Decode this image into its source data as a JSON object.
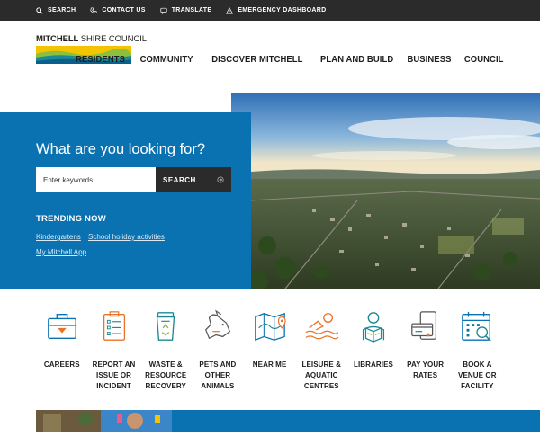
{
  "utility_bar": {
    "search": "SEARCH",
    "contact": "CONTACT US",
    "translate": "TRANSLATE",
    "emergency": "EMERGENCY DASHBOARD"
  },
  "logo": {
    "bold": "MITCHELL",
    "light": " SHIRE COUNCIL"
  },
  "nav": [
    "RESIDENTS",
    "COMMUNITY",
    "DISCOVER MITCHELL",
    "PLAN AND BUILD",
    "BUSINESS",
    "COUNCIL"
  ],
  "search": {
    "title": "What are you looking for?",
    "placeholder": "Enter keywords...",
    "button": "SEARCH"
  },
  "trending": {
    "title": "TRENDING NOW",
    "links": [
      "Kindergartens",
      "School holiday activities",
      "My Mitchell App"
    ]
  },
  "tiles": [
    {
      "label": "CAREERS",
      "icon": "briefcase-icon"
    },
    {
      "label": "REPORT AN ISSUE OR INCIDENT",
      "icon": "clipboard-icon"
    },
    {
      "label": "WASTE & RESOURCE RECOVERY",
      "icon": "recycle-bin-icon"
    },
    {
      "label": "PETS AND OTHER ANIMALS",
      "icon": "dog-icon"
    },
    {
      "label": "NEAR ME",
      "icon": "map-pin-icon"
    },
    {
      "label": "LEISURE & AQUATIC CENTRES",
      "icon": "swimmer-icon"
    },
    {
      "label": "LIBRARIES",
      "icon": "reader-icon"
    },
    {
      "label": "PAY YOUR RATES",
      "icon": "payment-icon"
    },
    {
      "label": "BOOK A VENUE OR FACILITY",
      "icon": "calendar-icon"
    }
  ],
  "colors": {
    "brand_blue": "#0b72b2",
    "orange": "#e8742a",
    "teal": "#1b8a92",
    "dark": "#2b2b2b"
  }
}
